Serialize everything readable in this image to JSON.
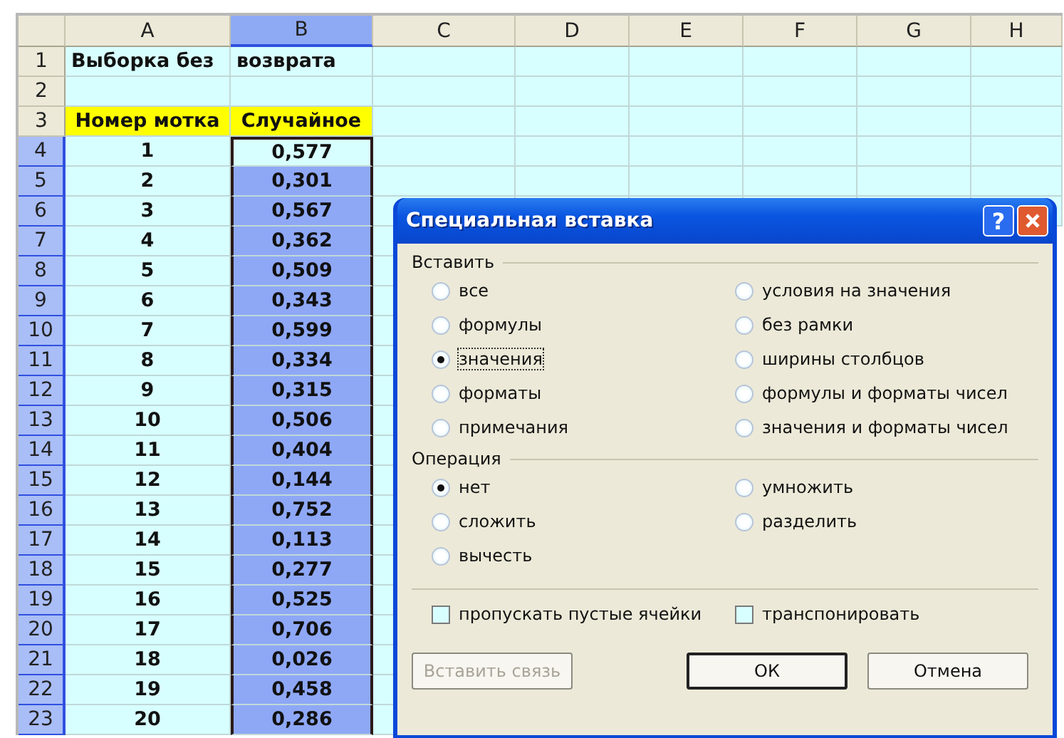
{
  "sheet": {
    "columns": [
      {
        "label": "A",
        "selected": false
      },
      {
        "label": "B",
        "selected": true
      },
      {
        "label": "C",
        "selected": false
      },
      {
        "label": "D",
        "selected": false
      },
      {
        "label": "E",
        "selected": false
      },
      {
        "label": "F",
        "selected": false
      },
      {
        "label": "G",
        "selected": false
      },
      {
        "label": "H",
        "selected": false
      }
    ],
    "rows": [
      {
        "header": "1",
        "selected": false,
        "active": false,
        "highlight": false,
        "cells": [
          "Выборка без",
          "возврата"
        ]
      },
      {
        "header": "2",
        "selected": false,
        "active": false,
        "highlight": false,
        "cells": []
      },
      {
        "header": "3",
        "selected": false,
        "active": false,
        "highlight": true,
        "cells": [
          "Номер мотка",
          "Случайное"
        ]
      },
      {
        "header": "4",
        "selected": true,
        "active": true,
        "highlight": false,
        "cells": [
          "1",
          "0,577"
        ]
      },
      {
        "header": "5",
        "selected": true,
        "active": false,
        "highlight": false,
        "cells": [
          "2",
          "0,301"
        ]
      },
      {
        "header": "6",
        "selected": true,
        "active": false,
        "highlight": false,
        "cells": [
          "3",
          "0,567"
        ]
      },
      {
        "header": "7",
        "selected": true,
        "active": false,
        "highlight": false,
        "cells": [
          "4",
          "0,362"
        ]
      },
      {
        "header": "8",
        "selected": true,
        "active": false,
        "highlight": false,
        "cells": [
          "5",
          "0,509"
        ]
      },
      {
        "header": "9",
        "selected": true,
        "active": false,
        "highlight": false,
        "cells": [
          "6",
          "0,343"
        ]
      },
      {
        "header": "10",
        "selected": true,
        "active": false,
        "highlight": false,
        "cells": [
          "7",
          "0,599"
        ]
      },
      {
        "header": "11",
        "selected": true,
        "active": false,
        "highlight": false,
        "cells": [
          "8",
          "0,334"
        ]
      },
      {
        "header": "12",
        "selected": true,
        "active": false,
        "highlight": false,
        "cells": [
          "9",
          "0,315"
        ]
      },
      {
        "header": "13",
        "selected": true,
        "active": false,
        "highlight": false,
        "cells": [
          "10",
          "0,506"
        ]
      },
      {
        "header": "14",
        "selected": true,
        "active": false,
        "highlight": false,
        "cells": [
          "11",
          "0,404"
        ]
      },
      {
        "header": "15",
        "selected": true,
        "active": false,
        "highlight": false,
        "cells": [
          "12",
          "0,144"
        ]
      },
      {
        "header": "16",
        "selected": true,
        "active": false,
        "highlight": false,
        "cells": [
          "13",
          "0,752"
        ]
      },
      {
        "header": "17",
        "selected": true,
        "active": false,
        "highlight": false,
        "cells": [
          "14",
          "0,113"
        ]
      },
      {
        "header": "18",
        "selected": true,
        "active": false,
        "highlight": false,
        "cells": [
          "15",
          "0,277"
        ]
      },
      {
        "header": "19",
        "selected": true,
        "active": false,
        "highlight": false,
        "cells": [
          "16",
          "0,525"
        ]
      },
      {
        "header": "20",
        "selected": true,
        "active": false,
        "highlight": false,
        "cells": [
          "17",
          "0,706"
        ]
      },
      {
        "header": "21",
        "selected": true,
        "active": false,
        "highlight": false,
        "cells": [
          "18",
          "0,026"
        ]
      },
      {
        "header": "22",
        "selected": true,
        "active": false,
        "highlight": false,
        "cells": [
          "19",
          "0,458"
        ]
      },
      {
        "header": "23",
        "selected": true,
        "active": false,
        "highlight": false,
        "cells": [
          "20",
          "0,286"
        ]
      }
    ]
  },
  "dialog": {
    "title": "Специальная вставка",
    "help_button": "?",
    "paste": {
      "label": "Вставить",
      "options": [
        {
          "label": "все",
          "selected": false
        },
        {
          "label": "формулы",
          "selected": false
        },
        {
          "label": "значения",
          "selected": true
        },
        {
          "label": "форматы",
          "selected": false
        },
        {
          "label": "примечания",
          "selected": false
        },
        {
          "label": "условия на значения",
          "selected": false
        },
        {
          "label": "без рамки",
          "selected": false
        },
        {
          "label": "ширины столбцов",
          "selected": false
        },
        {
          "label": "формулы и форматы чисел",
          "selected": false
        },
        {
          "label": "значения и форматы чисел",
          "selected": false
        }
      ]
    },
    "operation": {
      "label": "Операция",
      "options": [
        {
          "label": "нет",
          "selected": true
        },
        {
          "label": "сложить",
          "selected": false
        },
        {
          "label": "вычесть",
          "selected": false
        },
        {
          "label": "умножить",
          "selected": false
        },
        {
          "label": "разделить",
          "selected": false
        }
      ]
    },
    "checkboxes": [
      {
        "label": "пропускать пустые ячейки",
        "checked": false
      },
      {
        "label": "транспонировать",
        "checked": false
      }
    ],
    "buttons": [
      {
        "label": "Вставить связь",
        "disabled": true,
        "default": false
      },
      {
        "label": "ОК",
        "disabled": false,
        "default": true
      },
      {
        "label": "Отмена",
        "disabled": false,
        "default": false
      }
    ]
  }
}
